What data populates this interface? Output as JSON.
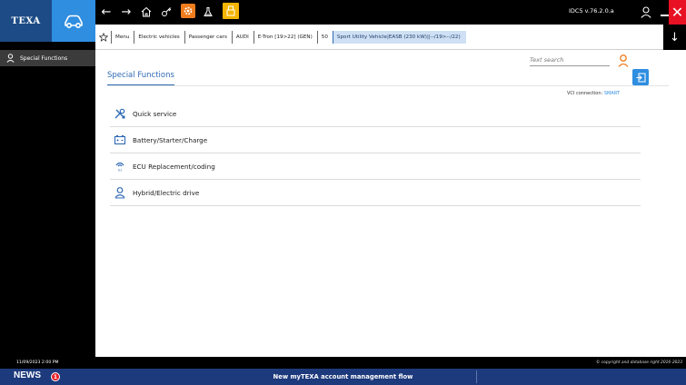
{
  "app": {
    "logo_text": "TEXA",
    "version": "IDC5 v.76.2.0.a"
  },
  "sidebar": {
    "active_item": "Special Functions",
    "datetime": "11/09/2023 2:00 PM"
  },
  "breadcrumb": [
    "Menu",
    "Electric vehicles",
    "Passenger cars",
    "AUDI",
    "E-Tron [19>22] (GEN)",
    "50",
    "Sport Utility Vehicle|EASB (230 kW)||--/19>--/22)"
  ],
  "search": {
    "placeholder": "Text search"
  },
  "page": {
    "tab_title": "Special Functions",
    "vci_label": "VCI connection:",
    "vci_value": "SMART"
  },
  "menu_items": [
    {
      "label": "Quick service",
      "icon": "wrench-screwdriver-icon"
    },
    {
      "label": "Battery/Starter/Charge",
      "icon": "battery-icon"
    },
    {
      "label": "ECU Replacement/coding",
      "icon": "ecu-chip-icon"
    },
    {
      "label": "Hybrid/Electric drive",
      "icon": "user-plug-icon"
    }
  ],
  "footer": {
    "copyright": "© copyright and database right 2016-2023",
    "news_label": "NEWS",
    "news_count": "1",
    "news_headline": "New myTEXA account management flow"
  },
  "colors": {
    "accent": "#2f8ee0",
    "brand_dark": "#1c4b86",
    "close_red": "#e81123",
    "news_bar": "#1d3a7c"
  }
}
